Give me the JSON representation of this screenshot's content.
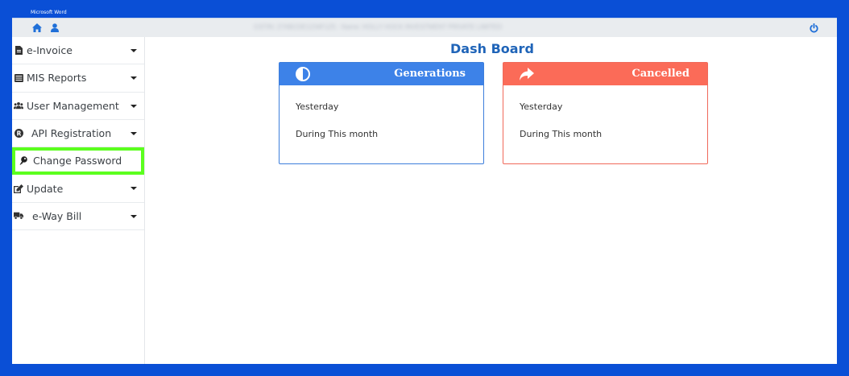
{
  "frame_label": "Microsoft Word",
  "topbar": {
    "org_text": "GSTIN: 27ABCDE1234F1Z5 - Name: HOLLY HOCK INVESTMENT PRIVATE LIMITED"
  },
  "sidebar": {
    "items": [
      {
        "label": "e-Invoice",
        "icon": "document-icon"
      },
      {
        "label": "MIS Reports",
        "icon": "list-icon"
      },
      {
        "label": "User Management",
        "icon": "users-icon"
      },
      {
        "label": "API Registration",
        "icon": "registered-icon"
      },
      {
        "label": "Change Password",
        "icon": "key-icon"
      },
      {
        "label": "Update",
        "icon": "edit-icon"
      },
      {
        "label": "e-Way Bill",
        "icon": "truck-icon"
      }
    ]
  },
  "main": {
    "title": "Dash Board",
    "cards": [
      {
        "title": "Generations",
        "icon": "half-circle-icon",
        "rows": [
          "Yesterday",
          "During This month"
        ],
        "color": "#3d82e8"
      },
      {
        "title": "Cancelled",
        "icon": "share-arrow-icon",
        "rows": [
          "Yesterday",
          "During This month"
        ],
        "color": "#fb6b58"
      }
    ]
  },
  "colors": {
    "frame": "#0a4fd6",
    "highlight": "#5bff1e",
    "title": "#1f64b8"
  }
}
